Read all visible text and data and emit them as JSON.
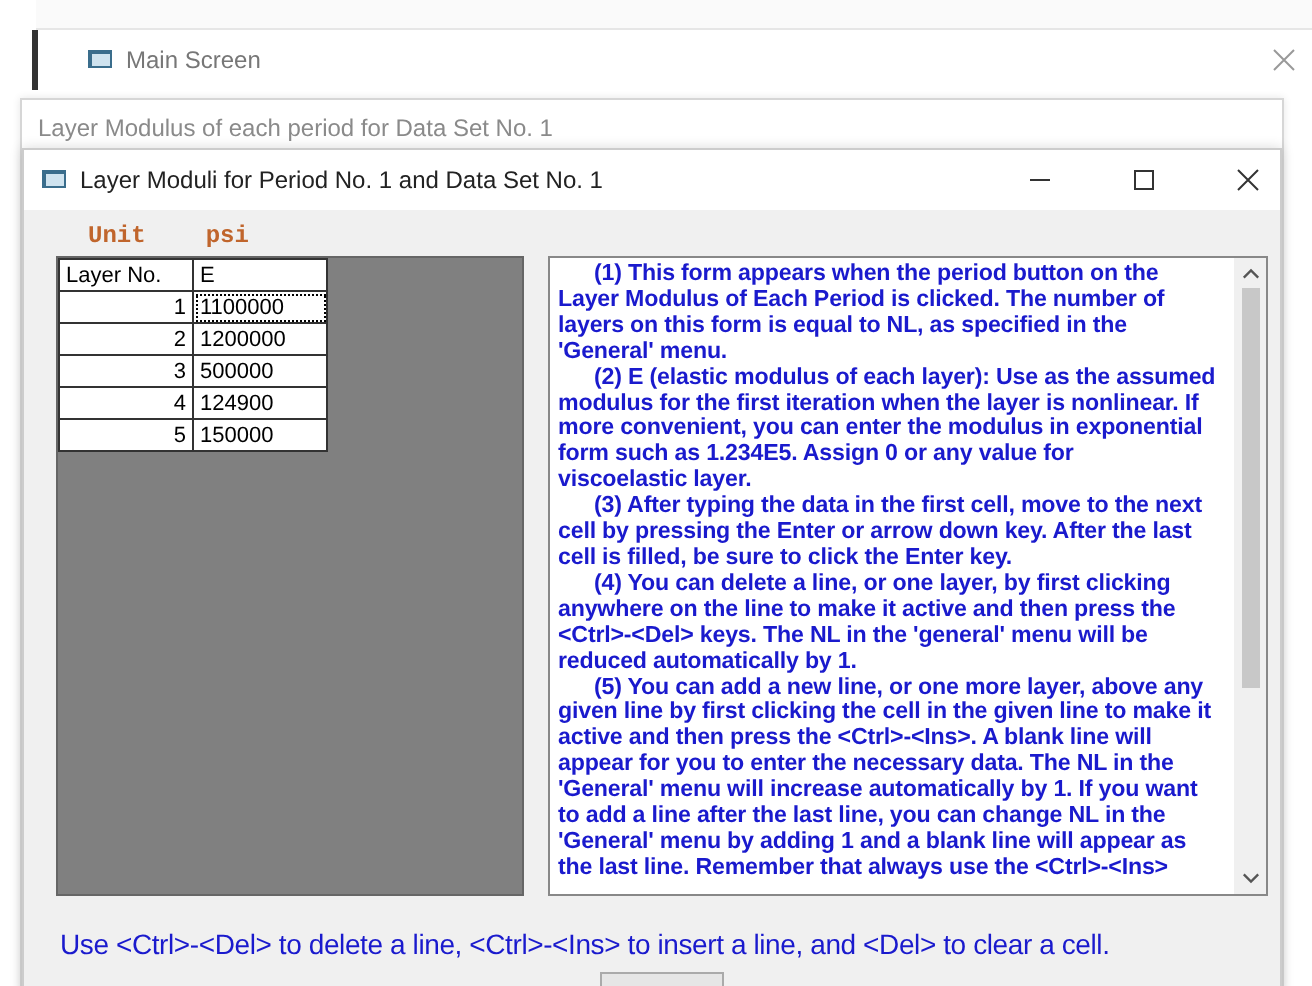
{
  "main_window": {
    "title": "Main Screen"
  },
  "background_window": {
    "title": "Layer Modulus of each period for Data Set No. 1"
  },
  "dialog": {
    "title": "Layer Moduli for Period No. 1 and Data Set No. 1",
    "unit_label": "Unit",
    "unit_value": "psi",
    "grid": {
      "columns": [
        "Layer No.",
        "E"
      ],
      "rows": [
        {
          "layer": "1",
          "e": "1100000",
          "focused": true
        },
        {
          "layer": "2",
          "e": "1200000",
          "focused": false
        },
        {
          "layer": "3",
          "e": "500000",
          "focused": false
        },
        {
          "layer": "4",
          "e": "124900",
          "focused": false
        },
        {
          "layer": "5",
          "e": "150000",
          "focused": false
        }
      ]
    },
    "help_lines": [
      {
        "text": "(1)  This form appears when the period button on the",
        "indent": true
      },
      {
        "text": "Layer Modulus of Each Period is clicked.  The number of",
        "indent": false
      },
      {
        "text": "layers on this form is equal to NL, as specified in the",
        "indent": false
      },
      {
        "text": "'General' menu.",
        "indent": false
      },
      {
        "text": "(2)  E (elastic modulus of each layer): Use as the assumed",
        "indent": true
      },
      {
        "text": "modulus for the first iteration when the layer is nonlinear.  If",
        "indent": false
      },
      {
        "text": "more convenient, you can enter the modulus in exponential",
        "indent": false
      },
      {
        "text": "form such as 1.234E5.  Assign 0 or any value for",
        "indent": false
      },
      {
        "text": "viscoelastic layer.",
        "indent": false
      },
      {
        "text": "(3)  After typing the data in the first cell, move to the next",
        "indent": true
      },
      {
        "text": "cell by pressing the Enter or arrow down key.  After the last",
        "indent": false
      },
      {
        "text": "cell is filled, be sure to click the Enter key.",
        "indent": false
      },
      {
        "text": "(4)  You can delete a line, or one layer, by first clicking",
        "indent": true
      },
      {
        "text": "anywhere on the line to make it active and then press the",
        "indent": false
      },
      {
        "text": "<Ctrl>-<Del> keys.  The NL in the 'general' menu will be",
        "indent": false
      },
      {
        "text": "reduced automatically by 1.",
        "indent": false
      },
      {
        "text": "(5) You can add a new line, or one more layer, above any",
        "indent": true
      },
      {
        "text": "given line by first clicking the cell in the given line to make it",
        "indent": false
      },
      {
        "text": "active and then press the <Ctrl>-<Ins>.  A blank line will",
        "indent": false
      },
      {
        "text": "appear for you to enter the necessary data.  The NL in the",
        "indent": false
      },
      {
        "text": "'General' menu will increase automatically by 1.  If you want",
        "indent": false
      },
      {
        "text": "to add a line after the last line, you can change NL in the",
        "indent": false
      },
      {
        "text": "'General' menu by adding 1 and a blank line will appear as",
        "indent": false
      },
      {
        "text": "the last line.  Remember that always use the <Ctrl>-<Ins>",
        "indent": false
      }
    ],
    "hint": "Use <Ctrl>-<Del> to delete a line, <Ctrl>-<Ins> to insert a line, and <Del> to clear a cell."
  }
}
